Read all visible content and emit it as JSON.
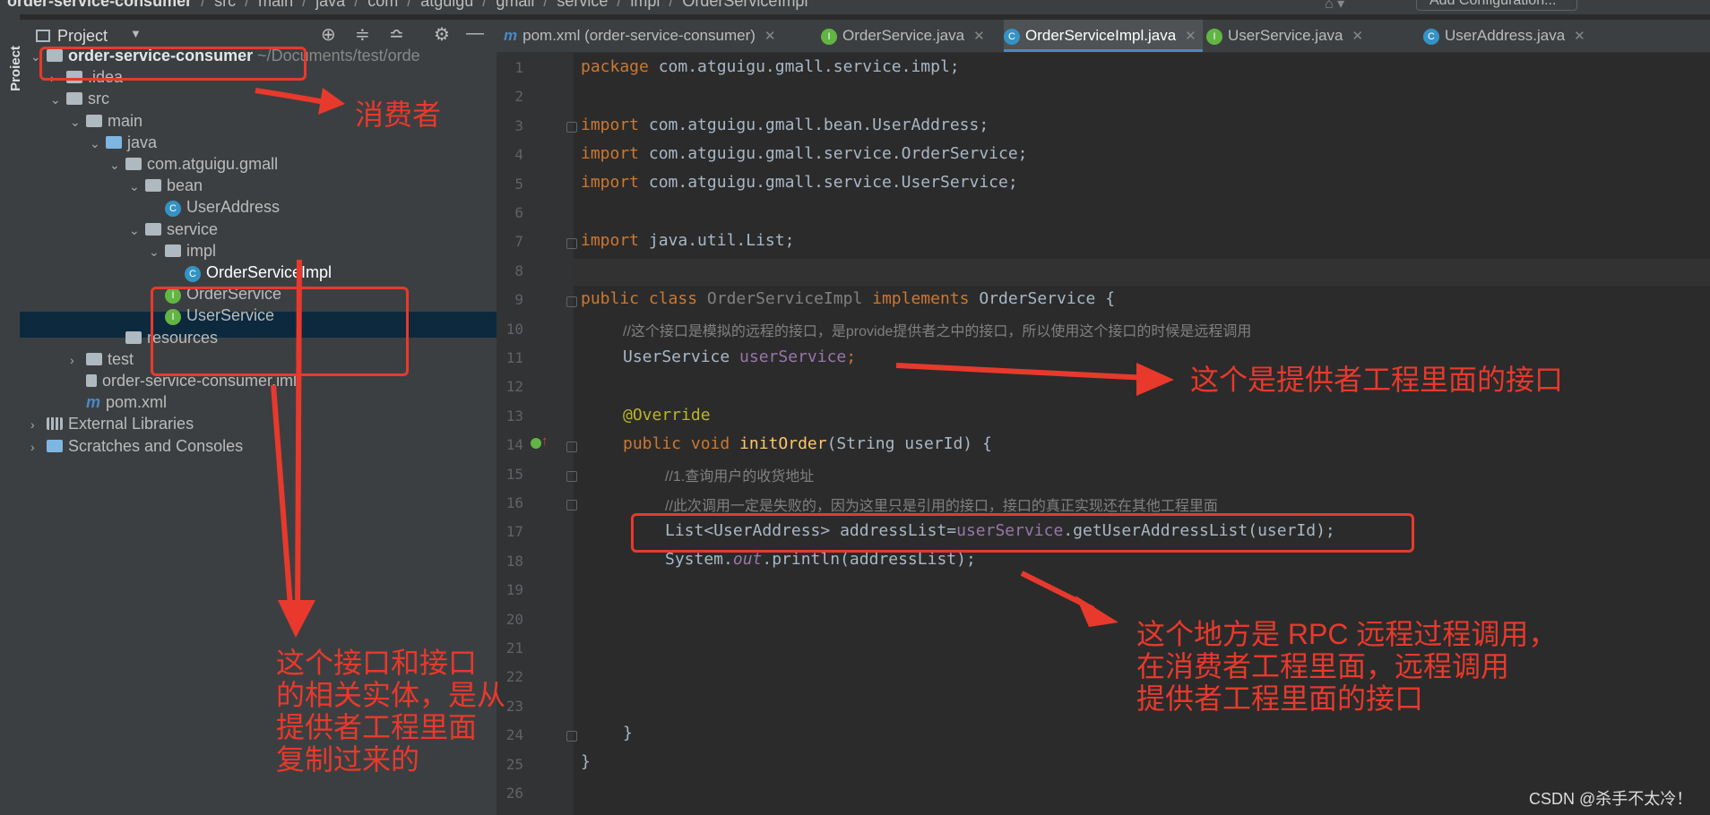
{
  "breadcrumb": [
    "order-service-consumer",
    "src",
    "main",
    "java",
    "com",
    "atguigu",
    "gmall",
    "service",
    "impl",
    "OrderServiceImpl"
  ],
  "toolbar": {
    "run_config": "Add Configuration..."
  },
  "side_strip_label": "Project",
  "project_panel": {
    "title": "Project",
    "tree": [
      {
        "label": "order-service-consumer",
        "path": "~/Documents/test/orde",
        "indent": 0,
        "kind": "module",
        "expanded": true
      },
      {
        "label": ".idea",
        "indent": 1,
        "kind": "folder",
        "expanded": false
      },
      {
        "label": "src",
        "indent": 1,
        "kind": "folder",
        "expanded": true
      },
      {
        "label": "main",
        "indent": 2,
        "kind": "folder",
        "expanded": true
      },
      {
        "label": "java",
        "indent": 3,
        "kind": "source-folder",
        "expanded": true
      },
      {
        "label": "com.atguigu.gmall",
        "indent": 4,
        "kind": "package",
        "expanded": true
      },
      {
        "label": "bean",
        "indent": 5,
        "kind": "package",
        "expanded": true
      },
      {
        "label": "UserAddress",
        "indent": 6,
        "kind": "class"
      },
      {
        "label": "service",
        "indent": 5,
        "kind": "package",
        "expanded": true
      },
      {
        "label": "impl",
        "indent": 6,
        "kind": "package",
        "expanded": true
      },
      {
        "label": "OrderServiceImpl",
        "indent": 7,
        "kind": "class",
        "selected": true
      },
      {
        "label": "OrderService",
        "indent": 6,
        "kind": "interface"
      },
      {
        "label": "UserService",
        "indent": 6,
        "kind": "interface"
      },
      {
        "label": "resources",
        "indent": 4,
        "kind": "resources"
      },
      {
        "label": "test",
        "indent": 2,
        "kind": "folder",
        "expanded": false
      },
      {
        "label": "order-service-consumer.iml",
        "indent": 2,
        "kind": "iml"
      },
      {
        "label": "pom.xml",
        "indent": 2,
        "kind": "maven"
      },
      {
        "label": "External Libraries",
        "indent": 0,
        "kind": "libraries",
        "expanded": false
      },
      {
        "label": "Scratches and Consoles",
        "indent": 0,
        "kind": "scratches",
        "expanded": false
      }
    ]
  },
  "tabs": [
    {
      "label": "pom.xml (order-service-consumer)",
      "kind": "maven"
    },
    {
      "label": "OrderService.java",
      "kind": "interface"
    },
    {
      "label": "OrderServiceImpl.java",
      "kind": "class",
      "active": true
    },
    {
      "label": "UserService.java",
      "kind": "interface"
    },
    {
      "label": "UserAddress.java",
      "kind": "class"
    }
  ],
  "code_lines": [
    "1",
    "2",
    "3",
    "4",
    "5",
    "6",
    "7",
    "8",
    "9",
    "10",
    "11",
    "12",
    "13",
    "14",
    "15",
    "16",
    "17",
    "18",
    "19",
    "20",
    "21",
    "22",
    "23",
    "24",
    "25",
    "26"
  ],
  "code": {
    "l1": [
      "package",
      " com.atguigu.gmall.service.impl;"
    ],
    "l3": [
      "import",
      " com.atguigu.gmall.bean.UserAddress;"
    ],
    "l4": [
      "import",
      " com.atguigu.gmall.service.OrderService;"
    ],
    "l5": [
      "import",
      " com.atguigu.gmall.service.UserService;"
    ],
    "l7": [
      "import",
      " java.util.List;"
    ],
    "l9": [
      "public class ",
      "OrderServiceImpl",
      " implements ",
      "OrderService {"
    ],
    "l10": "//这个接口是模拟的远程的接口，是provide提供者之中的接口，所以使用这个接口的时候是远程调用",
    "l11": [
      "UserService ",
      "userService",
      ";"
    ],
    "l13": "@Override",
    "l14": [
      "public void ",
      "initOrder",
      "(String userId) {"
    ],
    "l15": "//1.查询用户的收货地址",
    "l16": "//此次调用一定是失败的，因为这里只是引用的接口，接口的真正实现还在其他工程里面",
    "l17": [
      "List<UserAddress> addressList=",
      "userService",
      ".getUserAddressList(userId);"
    ],
    "l18": [
      "System.",
      "out",
      ".println(addressList);"
    ],
    "l24": "}",
    "l25": "}"
  },
  "annotations": {
    "consumer": "消费者",
    "copied": [
      "这个接口和接口",
      "的相关实体，是从",
      "提供者工程里面",
      "复制过来的"
    ],
    "provider_interface": "这个是提供者工程里面的接口",
    "rpc": [
      "这个地方是 RPC 远程过程调用，",
      "在消费者工程里面，远程调用",
      "提供者工程里面的接口"
    ]
  },
  "watermark": "CSDN @杀手不太冷！",
  "colors": {
    "annotation_red": "#e8392c",
    "selection": "#0d293e",
    "keyword": "#cc7832"
  }
}
